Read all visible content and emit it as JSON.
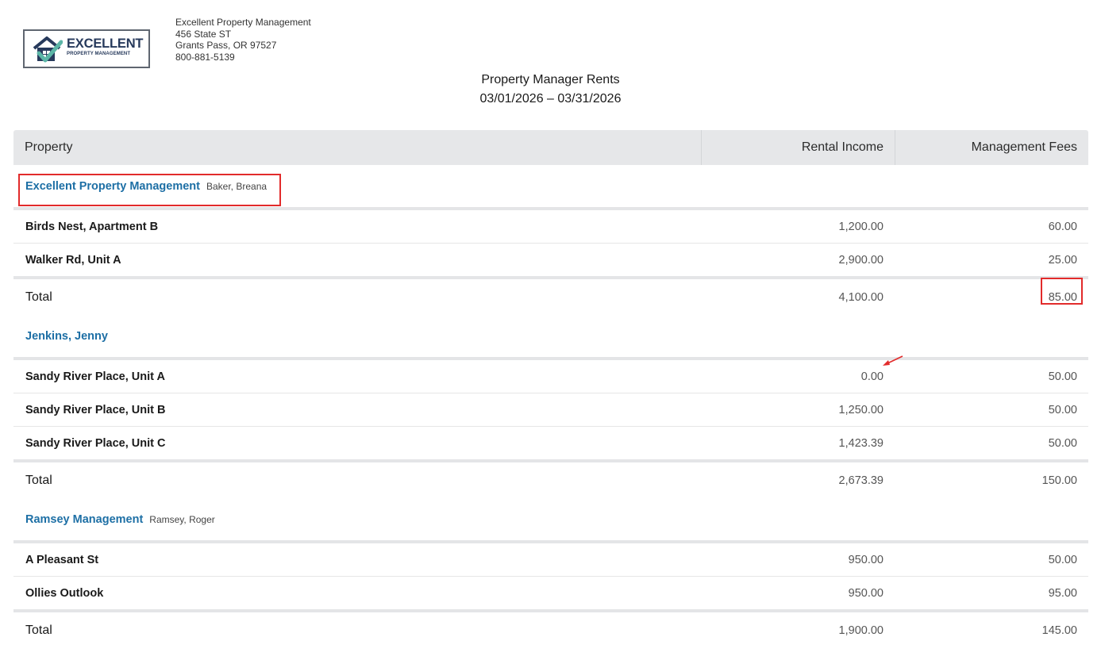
{
  "company": {
    "logo": {
      "word": "EXCELLENT",
      "sub": "PROPERTY MANAGEMENT"
    },
    "name": "Excellent Property Management",
    "street": "456 State ST",
    "city": "Grants Pass, OR 97527",
    "phone": "800-881-5139"
  },
  "report": {
    "title": "Property Manager Rents",
    "period": "03/01/2026 – 03/31/2026"
  },
  "columns": {
    "property": "Property",
    "income": "Rental Income",
    "fees": "Management Fees"
  },
  "groups": [
    {
      "name": "Excellent Property Management",
      "manager": "Baker, Breana",
      "rows": [
        {
          "property": "Birds Nest, Apartment B",
          "income": "1,200.00",
          "fees": "60.00"
        },
        {
          "property": "Walker Rd, Unit A",
          "income": "2,900.00",
          "fees": "25.00"
        }
      ],
      "total": {
        "label": "Total",
        "income": "4,100.00",
        "fees": "85.00"
      }
    },
    {
      "name": "Jenkins, Jenny",
      "manager": "",
      "rows": [
        {
          "property": "Sandy River Place, Unit A",
          "income": "0.00",
          "fees": "50.00"
        },
        {
          "property": "Sandy River Place, Unit B",
          "income": "1,250.00",
          "fees": "50.00"
        },
        {
          "property": "Sandy River Place, Unit C",
          "income": "1,423.39",
          "fees": "50.00"
        }
      ],
      "total": {
        "label": "Total",
        "income": "2,673.39",
        "fees": "150.00"
      }
    },
    {
      "name": "Ramsey Management",
      "manager": "Ramsey, Roger",
      "rows": [
        {
          "property": "A Pleasant St",
          "income": "950.00",
          "fees": "50.00"
        },
        {
          "property": "Ollies Outlook",
          "income": "950.00",
          "fees": "95.00"
        }
      ],
      "total": {
        "label": "Total",
        "income": "1,900.00",
        "fees": "145.00"
      }
    }
  ],
  "colors": {
    "link": "#1d6fa5",
    "header_bg": "#e6e7e9",
    "annotation": "#e22b2b"
  },
  "icons": {
    "logo": "house-checkmark-icon",
    "annotation": "red-arrow-icon"
  }
}
